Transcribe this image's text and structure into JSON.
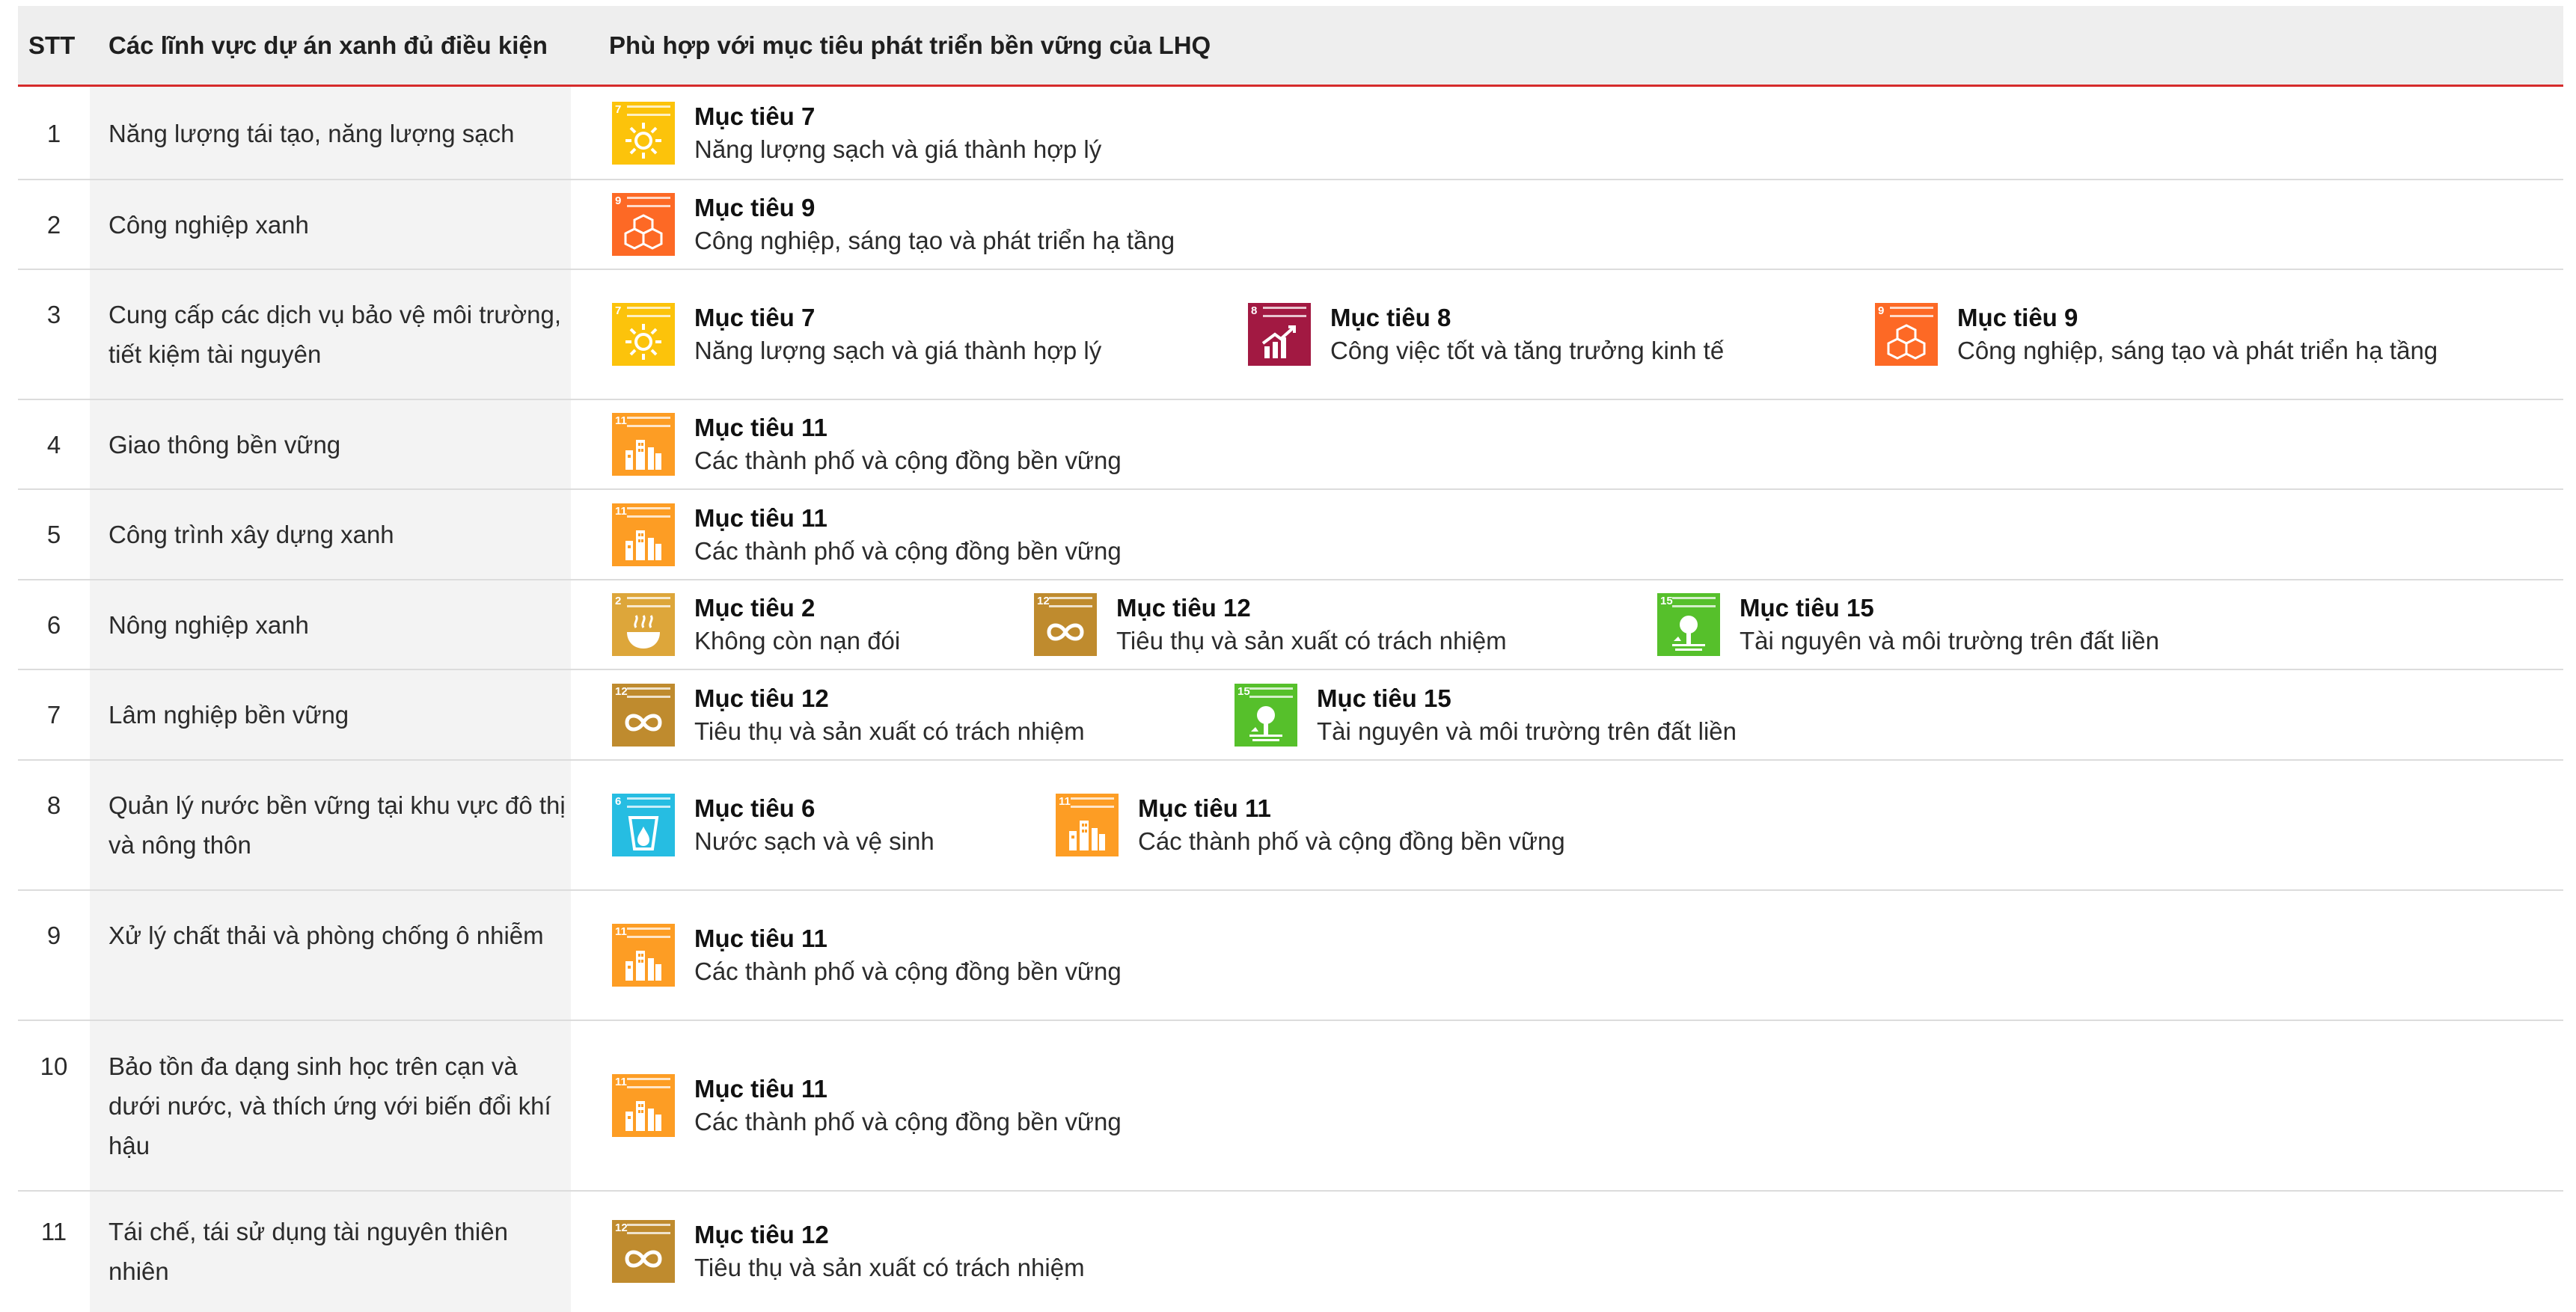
{
  "header": {
    "stt": "STT",
    "field": "Các lĩnh vực dự án xanh đủ điều kiện",
    "sdg": "Phù hợp với mục tiêu phát triển bền vững của LHQ"
  },
  "colors": {
    "header_rule": "#d62b2b",
    "sdg2": "#dda63a",
    "sdg6": "#26bde2",
    "sdg7": "#fcc30b",
    "sdg8": "#a21942",
    "sdg9": "#fd6925",
    "sdg11": "#fd9d24",
    "sdg12": "#bf8b2e",
    "sdg15": "#56c02b"
  },
  "rows": [
    {
      "stt": "1",
      "field": "Năng lượng tái tạo, năng lượng sạch",
      "goals": [
        {
          "title": "Mục tiêu 7",
          "desc": "Năng lượng sạch và giá thành hợp lý",
          "icon": "sdg-7-sun-icon"
        }
      ]
    },
    {
      "stt": "2",
      "field": "Công nghiệp xanh",
      "goals": [
        {
          "title": "Mục tiêu 9",
          "desc": "Công nghiệp, sáng tạo và phát triển hạ tầng",
          "icon": "sdg-9-cubes-icon"
        }
      ]
    },
    {
      "stt": "3",
      "field": "Cung cấp các dịch vụ bảo vệ môi trường, tiết kiệm tài nguyên",
      "goals": [
        {
          "title": "Mục tiêu 7",
          "desc": "Năng lượng sạch và giá thành hợp lý",
          "icon": "sdg-7-sun-icon"
        },
        {
          "title": "Mục tiêu 8",
          "desc": "Công việc tốt và tăng trưởng kinh tế",
          "icon": "sdg-8-chart-icon"
        },
        {
          "title": "Mục tiêu 9",
          "desc": "Công nghiệp, sáng tạo và phát triển hạ tầng",
          "icon": "sdg-9-cubes-icon"
        }
      ]
    },
    {
      "stt": "4",
      "field": "Giao thông bền vững",
      "goals": [
        {
          "title": "Mục tiêu 11",
          "desc": "Các thành phố và cộng đồng bền vững",
          "icon": "sdg-11-city-icon"
        }
      ]
    },
    {
      "stt": "5",
      "field": "Công trình xây dựng xanh",
      "goals": [
        {
          "title": "Mục tiêu 11",
          "desc": "Các thành phố và cộng đồng bền vững",
          "icon": "sdg-11-city-icon"
        }
      ]
    },
    {
      "stt": "6",
      "field": "Nông nghiệp xanh",
      "goals": [
        {
          "title": "Mục tiêu 2",
          "desc": "Không còn nạn đói",
          "icon": "sdg-2-bowl-icon"
        },
        {
          "title": "Mục tiêu 12",
          "desc": "Tiêu thụ và sản xuất có trách nhiệm",
          "icon": "sdg-12-infinity-icon"
        },
        {
          "title": "Mục tiêu 15",
          "desc": "Tài nguyên và môi trường trên đất liền",
          "icon": "sdg-15-tree-icon"
        }
      ]
    },
    {
      "stt": "7",
      "field": "Lâm nghiệp bền vững",
      "goals": [
        {
          "title": "Mục tiêu 12",
          "desc": "Tiêu thụ và sản xuất có trách nhiệm",
          "icon": "sdg-12-infinity-icon"
        },
        {
          "title": "Mục tiêu 15",
          "desc": "Tài nguyên và môi trường trên đất liền",
          "icon": "sdg-15-tree-icon"
        }
      ]
    },
    {
      "stt": "8",
      "field": "Quản lý nước bền vững tại khu vực đô thị và nông thôn",
      "goals": [
        {
          "title": "Mục tiêu 6",
          "desc": "Nước sạch và vệ sinh",
          "icon": "sdg-6-water-icon"
        },
        {
          "title": "Mục tiêu 11",
          "desc": "Các thành phố và cộng đồng bền vững",
          "icon": "sdg-11-city-icon"
        }
      ]
    },
    {
      "stt": "9",
      "field": "Xử lý chất thải và phòng chống ô nhiễm",
      "goals": [
        {
          "title": "Mục tiêu 11",
          "desc": "Các thành phố và cộng đồng bền vững",
          "icon": "sdg-11-city-icon"
        }
      ]
    },
    {
      "stt": "10",
      "field": "Bảo tồn đa dạng sinh học trên cạn và dưới nước, và thích ứng với biến đổi khí hậu",
      "goals": [
        {
          "title": "Mục tiêu 11",
          "desc": "Các thành phố và cộng đồng bền vững",
          "icon": "sdg-11-city-icon"
        }
      ]
    },
    {
      "stt": "11",
      "field": "Tái chế, tái sử dụng tài nguyên thiên nhiên",
      "goals": [
        {
          "title": "Mục tiêu 12",
          "desc": "Tiêu thụ và sản xuất có trách nhiệm",
          "icon": "sdg-12-infinity-icon"
        }
      ]
    }
  ]
}
